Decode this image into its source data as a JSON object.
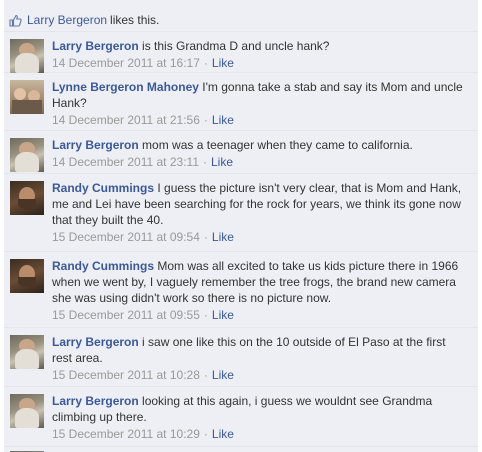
{
  "likes": {
    "name": "Larry Bergeron",
    "suffix": "likes this."
  },
  "comments": [
    {
      "author": "Larry Bergeron",
      "text": "is this Grandma D and uncle hank?",
      "date": "14 December 2011 at 16:17",
      "like": "Like"
    },
    {
      "author": "Lynne Bergeron Mahoney",
      "text": "I'm gonna take a stab and say its Mom and uncle Hank?",
      "date": "14 December 2011 at 21:56",
      "like": "Like"
    },
    {
      "author": "Larry Bergeron",
      "text": "mom was a teenager when they came to california.",
      "date": "14 December 2011 at 23:11",
      "like": "Like"
    },
    {
      "author": "Randy Cummings",
      "text": "I guess the picture isn't very clear, that is Mom and Hank, me and Lei have been searching for the rock for years, we think its gone now that they built the 40.",
      "date": "15 December 2011 at 09:54",
      "like": "Like"
    },
    {
      "author": "Randy Cummings",
      "text": "Mom was all excited to take us kids picture there in 1966 when we went by, I vaguely remember the tree frogs, the brand new camera she was using didn't work so there is no picture now.",
      "date": "15 December 2011 at 09:55",
      "like": "Like"
    },
    {
      "author": "Larry Bergeron",
      "text": "i saw one like this on the 10 outside of El Paso at the first rest area.",
      "date": "15 December 2011 at 10:28",
      "like": "Like"
    },
    {
      "author": "Larry Bergeron",
      "text": "looking at this again, i guess we wouldnt see Grandma climbing up there.",
      "date": "15 December 2011 at 10:29",
      "like": "Like"
    }
  ],
  "separator": "·"
}
